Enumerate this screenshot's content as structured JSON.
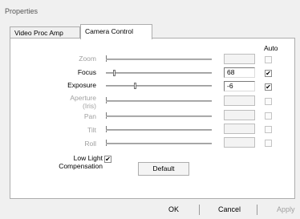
{
  "window": {
    "title": "Properties"
  },
  "tabs": [
    {
      "label": "Video Proc Amp",
      "active": false
    },
    {
      "label": "Camera Control",
      "active": true
    }
  ],
  "auto_header": "Auto",
  "controls": [
    {
      "label": "Zoom",
      "enabled": false,
      "value": "",
      "auto": false,
      "level": 0.0
    },
    {
      "label": "Focus",
      "enabled": true,
      "value": "68",
      "auto": true,
      "level": 0.07
    },
    {
      "label": "Exposure",
      "enabled": true,
      "value": "-6",
      "auto": true,
      "level": 0.27
    },
    {
      "label": "Aperture (Iris)",
      "label_line1": "Aperture",
      "label_line2": "(Iris)",
      "enabled": false,
      "value": "",
      "auto": false,
      "level": 0.0
    },
    {
      "label": "Pan",
      "enabled": false,
      "value": "",
      "auto": false,
      "level": 0.0
    },
    {
      "label": "Tilt",
      "enabled": false,
      "value": "",
      "auto": false,
      "level": 0.0
    },
    {
      "label": "Roll",
      "enabled": false,
      "value": "",
      "auto": false,
      "level": 0.0
    }
  ],
  "low_light": {
    "line1": "Low Light",
    "line2": "Compensation",
    "checked": true
  },
  "default_button": "Default",
  "buttons": {
    "ok": "OK",
    "cancel": "Cancel",
    "apply": "Apply"
  }
}
